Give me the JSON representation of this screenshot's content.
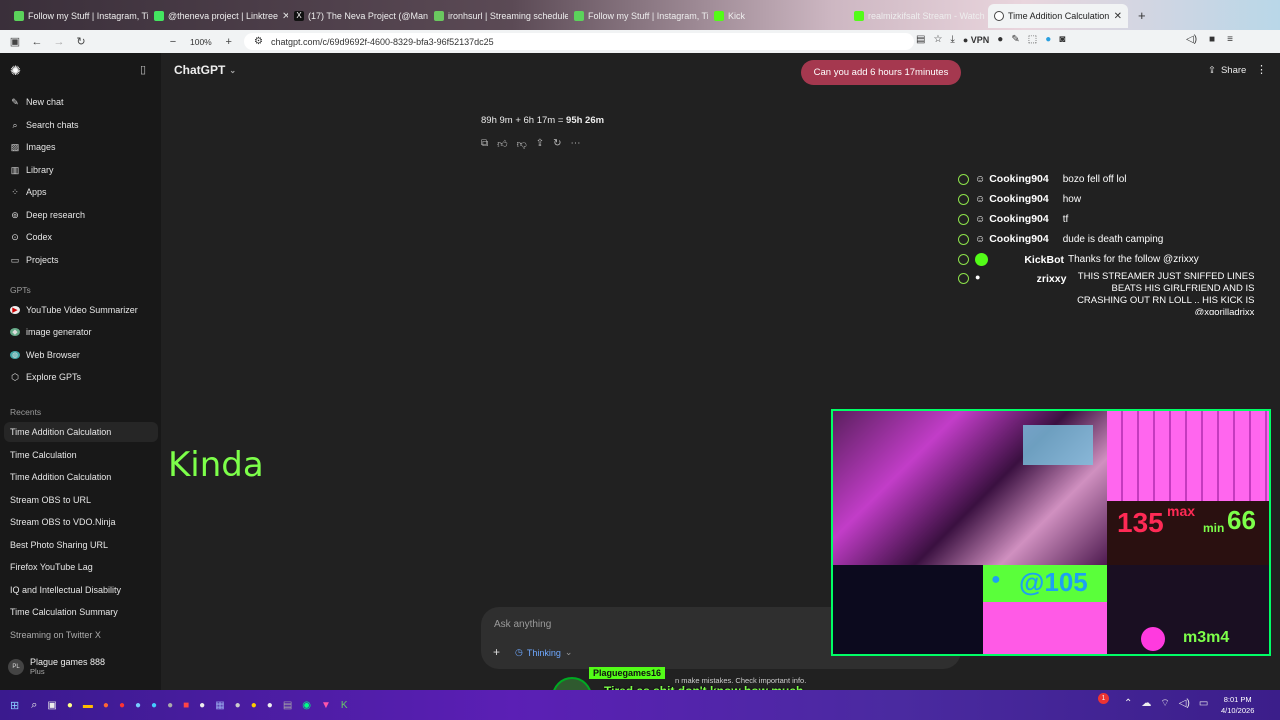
{
  "browser": {
    "tabs": [
      {
        "title": "Follow my Stuff | Instagram, Tik",
        "color": "#5bd35b"
      },
      {
        "title": "@theneva project | Linktree",
        "color": "#43e660"
      },
      {
        "title": "(17) The Neva Project (@Man",
        "color": "#111111"
      },
      {
        "title": "ironhsurl | Streaming schedule",
        "color": "#6ac85f"
      },
      {
        "title": "Follow my Stuff | Instagram, Tik",
        "color": "#5bd35b"
      },
      {
        "title": "Kick",
        "color": "#53fc18"
      },
      {
        "title": "realmizkifsalt Stream - Watch L",
        "color": "#53fc18"
      },
      {
        "title": "Time Addition Calculation",
        "color": "#444444"
      }
    ],
    "zoom": "100%",
    "url": "chatgpt.com/c/69d9692f-4600-8329-bfa3-96f52137dc25",
    "vpn": "VPN"
  },
  "sidebar": {
    "items": [
      {
        "label": "New chat",
        "icon": "edit-icon"
      },
      {
        "label": "Search chats",
        "icon": "search-icon"
      },
      {
        "label": "Images",
        "icon": "image-icon"
      },
      {
        "label": "Library",
        "icon": "library-icon"
      },
      {
        "label": "Apps",
        "icon": "apps-icon"
      },
      {
        "label": "Deep research",
        "icon": "telescope-icon"
      },
      {
        "label": "Codex",
        "icon": "codex-icon"
      },
      {
        "label": "Projects",
        "icon": "folder-icon"
      }
    ],
    "gpts_label": "GPTs",
    "gpts": [
      {
        "label": "YouTube Video Summarizer"
      },
      {
        "label": "image generator"
      },
      {
        "label": "Web Browser"
      },
      {
        "label": "Explore GPTs"
      }
    ],
    "recents_label": "Recents",
    "recents": [
      "Time Addition Calculation",
      "Time Calculation",
      "Time Addition Calculation",
      "Stream OBS to URL",
      "Stream OBS to VDO.Ninja",
      "Best Photo Sharing URL",
      "Firefox YouTube Lag",
      "IQ and Intellectual Disability",
      "Time Calculation Summary",
      "Streaming on Twitter X"
    ],
    "user": {
      "name": "Plague games 888",
      "plan": "Plus",
      "initials": "PL"
    }
  },
  "header": {
    "model": "ChatGPT",
    "share": "Share"
  },
  "conversation": {
    "user_message": "Can you add 6 hours 17minutes",
    "answer_prefix": "89h 9m + 6h 17m = ",
    "answer_bold": "95h 26m"
  },
  "overlay": {
    "big_text": "Kinda"
  },
  "composer": {
    "placeholder": "Ask anything",
    "mode": "Thinking",
    "disclaimer": "n make mistakes. Check important info."
  },
  "stream_chat": [
    {
      "user": "Cooking904",
      "msg": "bozo fell off lol"
    },
    {
      "user": "Cooking904",
      "msg": "how"
    },
    {
      "user": "Cooking904",
      "msg": "tf"
    },
    {
      "user": "Cooking904",
      "msg": "dude is death camping"
    },
    {
      "user": "KickBot",
      "msg": "Thanks for the follow @zrixxy"
    },
    {
      "user": "zrixxy",
      "msg": "THIS STREAMER JUST SNIFFED LINES BEATS HIS GIRLFRIEND AND IS CRASHING OUT RN LOLL .. HIS KICK IS @xgorilladrixx"
    }
  ],
  "stream_overlay": {
    "hr": "135",
    "hr_max": "max",
    "hr_min": "min",
    "hr_min_val": "66",
    "twitter": "@105",
    "handle": "m3m4",
    "alert_user": "Plaguegames16",
    "alert_msg": "Tired as shit don't know how much Longer i stream"
  },
  "taskbar": {
    "time": "8:01 PM",
    "date": "4/10/2026",
    "badge": "1"
  }
}
